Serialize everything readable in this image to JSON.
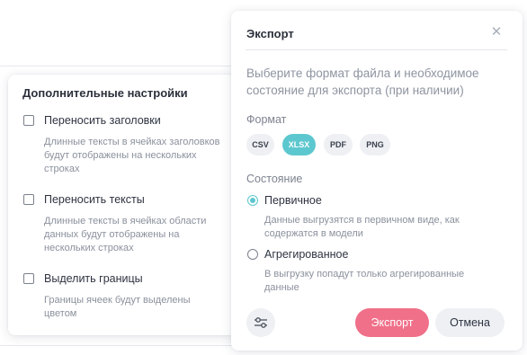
{
  "advanced_settings": {
    "title": "Дополнительные настройки",
    "options": [
      {
        "label": "Переносить заголовки",
        "description": "Длинные тексты в ячейках заголовков будут отображены на нескольких строках",
        "checked": false
      },
      {
        "label": "Переносить тексты",
        "description": "Длинные тексты в ячейках области данных будут отображены на нескольких строках",
        "checked": false
      },
      {
        "label": "Выделить границы",
        "description": "Границы ячеек будут выделены цветом",
        "checked": false
      }
    ]
  },
  "export_dialog": {
    "title": "Экспорт",
    "close_icon": "close-icon",
    "hint": "Выберите формат файла и необходимое состояние для экспорта (при наличии)",
    "format_label": "Формат",
    "formats": [
      "CSV",
      "XLSX",
      "PDF",
      "PNG"
    ],
    "selected_format": "XLSX",
    "state_label": "Состояние",
    "states": [
      {
        "label": "Первичное",
        "description": "Данные выгрузятся в первичном виде, как содержатся в модели",
        "selected": true
      },
      {
        "label": "Агрегированное",
        "description": "В выгрузку попадут только агрегированные данные",
        "selected": false
      }
    ],
    "settings_icon": "sliders-icon",
    "export_label": "Экспорт",
    "cancel_label": "Отмена"
  },
  "colors": {
    "accent": "#5dc7cf",
    "primary_button": "#f07089",
    "secondary_button": "#eef0f4",
    "muted_text": "#8a909c"
  }
}
